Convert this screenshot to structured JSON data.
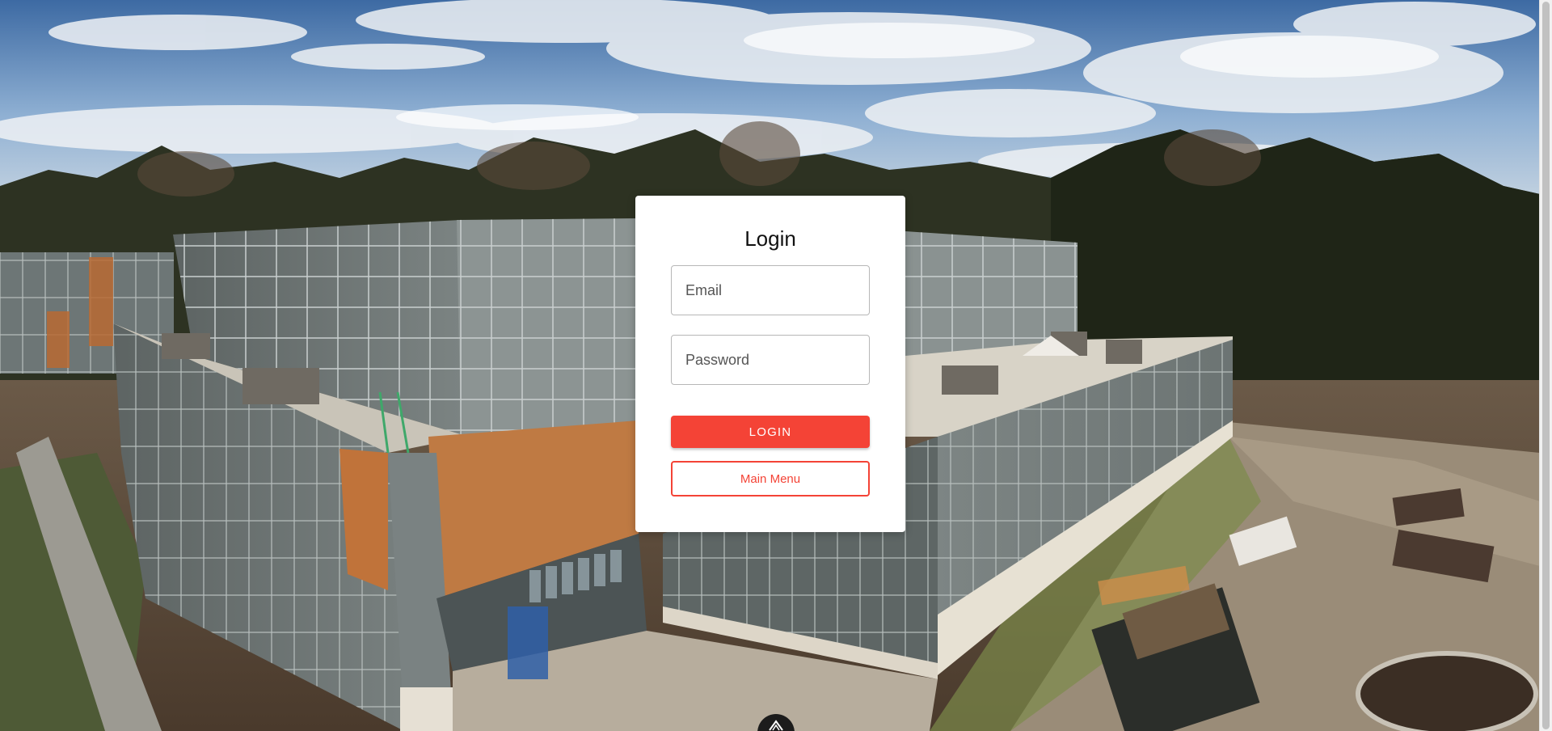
{
  "login": {
    "title": "Login",
    "email_placeholder": "Email",
    "password_placeholder": "Password",
    "login_button": "LOGIN",
    "main_menu_button": "Main Menu"
  },
  "colors": {
    "accent": "#f44336",
    "card_background": "#ffffff"
  },
  "icons": {
    "bottom_button": "logo-mountain-icon"
  }
}
